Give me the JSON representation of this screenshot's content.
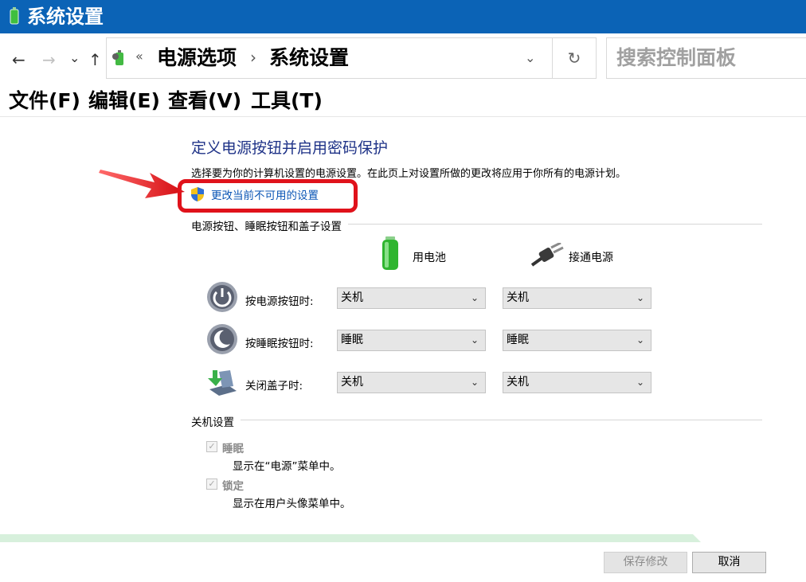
{
  "window": {
    "title": "系统设置"
  },
  "nav": {
    "back": "←",
    "forward": "→",
    "recent": "⌄",
    "up": "↑",
    "breadcrumb_chevron": "«",
    "breadcrumbs": [
      "电源选项",
      "系统设置"
    ],
    "breadcrumb_sep": "›",
    "address_dropdown": "⌄",
    "refresh": "↻",
    "search_placeholder": "搜索控制面板"
  },
  "menu": [
    "文件(F)",
    "编辑(E)",
    "查看(V)",
    "工具(T)"
  ],
  "page": {
    "heading": "定义电源按钮并启用密码保护",
    "description": "选择要为你的计算机设置的电源设置。在此页上对设置所做的更改将应用于你所有的电源计划。",
    "change_link": "更改当前不可用的设置"
  },
  "buttons_section": {
    "title": "电源按钮、睡眠按钮和盖子设置",
    "columns": [
      "用电池",
      "接通电源"
    ],
    "rows": [
      {
        "label": "按电源按钮时:",
        "battery": "关机",
        "plugged": "关机",
        "icon": "power-button-icon"
      },
      {
        "label": "按睡眠按钮时:",
        "battery": "睡眠",
        "plugged": "睡眠",
        "icon": "sleep-button-icon"
      },
      {
        "label": "关闭盖子时:",
        "battery": "关机",
        "plugged": "关机",
        "icon": "laptop-lid-icon"
      }
    ]
  },
  "shutdown_section": {
    "title": "关机设置",
    "items": [
      {
        "label": "睡眠",
        "desc": "显示在“电源”菜单中。",
        "checked": true
      },
      {
        "label": "锁定",
        "desc": "显示在用户头像菜单中。",
        "checked": true
      }
    ]
  },
  "footer": {
    "save": "保存修改",
    "cancel": "取消"
  },
  "colors": {
    "titlebar": "#0b63b6",
    "heading": "#1e3287",
    "link": "#0a55b5",
    "highlight": "#e0121b"
  }
}
